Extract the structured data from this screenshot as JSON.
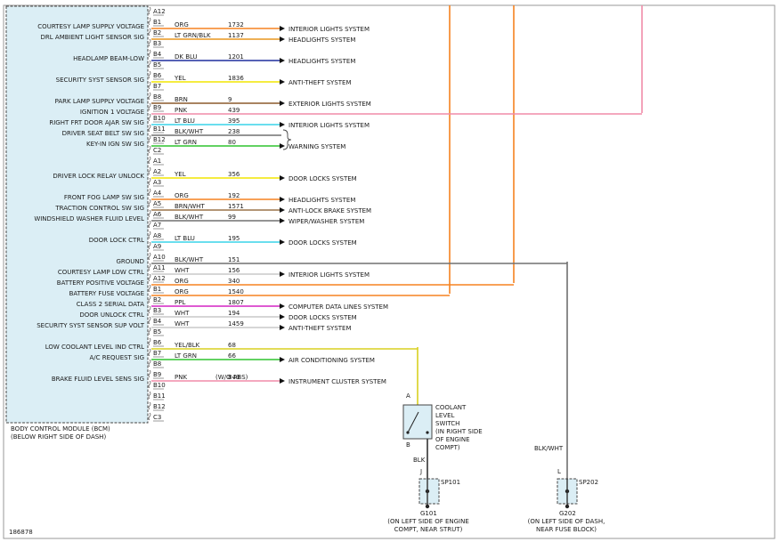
{
  "diagram": {
    "figure_id": "186878",
    "module": {
      "name_line1": "BODY CONTROL MODULE (BCM)",
      "name_line2": "(BELOW RIGHT SIDE OF DASH)"
    },
    "colors": {
      "module_fill": "#dbeef5",
      "ORG": "#f58220",
      "LT GRN/BLK": "#e8961e",
      "LT GRN": "#2ec42e",
      "DK BLU": "#1f2f9e",
      "YEL": "#f2e600",
      "BRN": "#8b5a2b",
      "PNK": "#f08ca8",
      "LT BLU": "#39d3e8",
      "BLK/WHT": "#707070",
      "BRN/WHT": "#9a7348",
      "WHT": "#c8c8c8",
      "PPL": "#d424c4",
      "YEL/BLK": "#d8d020",
      "BLK": "#333333"
    },
    "pins": [
      {
        "pin": "A12",
        "label": "",
        "color": "",
        "circuit": "",
        "dest": ""
      },
      {
        "pin": "B1",
        "label": "COURTESY LAMP SUPPLY VOLTAGE",
        "color": "ORG",
        "circuit": "1732",
        "dest": ""
      },
      {
        "pin": "B2",
        "label": "DRL AMBIENT LIGHT SENSOR SIG",
        "color": "LT GRN/BLK",
        "circuit": "1137",
        "dest": "INTERIOR LIGHTS SYSTEM"
      },
      {
        "pin": "B3",
        "label": "",
        "color": "",
        "circuit": "",
        "dest": "HEADLIGHTS SYSTEM"
      },
      {
        "pin": "B4",
        "label": "HEADLAMP BEAM-LOW",
        "color": "DK BLU",
        "circuit": "1201",
        "dest": ""
      },
      {
        "pin": "B5",
        "label": "",
        "color": "",
        "circuit": "",
        "dest": "HEADLIGHTS SYSTEM"
      },
      {
        "pin": "B6",
        "label": "SECURITY SYST SENSOR SIG",
        "color": "YEL",
        "circuit": "1836",
        "dest": ""
      },
      {
        "pin": "B7",
        "label": "",
        "color": "",
        "circuit": "",
        "dest": "ANTI-THEFT SYSTEM"
      },
      {
        "pin": "B8",
        "label": "PARK LAMP SUPPLY VOLTAGE",
        "color": "BRN",
        "circuit": "9",
        "dest": ""
      },
      {
        "pin": "B9",
        "label": "IGNITION 1 VOLTAGE",
        "color": "PNK",
        "circuit": "439",
        "dest": "EXTERIOR LIGHTS SYSTEM"
      },
      {
        "pin": "B10",
        "label": "RIGHT FRT DOOR AJAR SW SIG",
        "color": "LT BLU",
        "circuit": "395",
        "dest": ""
      },
      {
        "pin": "B11",
        "label": "DRIVER SEAT BELT SW SIG",
        "color": "BLK/WHT",
        "circuit": "238",
        "dest": "INTERIOR LIGHTS SYSTEM"
      },
      {
        "pin": "B12",
        "label": "KEY-IN IGN SW SIG",
        "color": "LT GRN",
        "circuit": "80",
        "dest": ""
      },
      {
        "pin": "C2",
        "label": "",
        "color": "",
        "circuit": "",
        "dest": "WARNING SYSTEM"
      },
      {
        "pin": "A1",
        "label": "",
        "color": "",
        "circuit": "",
        "dest": ""
      },
      {
        "pin": "A2",
        "label": "DRIVER LOCK RELAY UNLOCK",
        "color": "YEL",
        "circuit": "356",
        "dest": ""
      },
      {
        "pin": "A3",
        "label": "",
        "color": "",
        "circuit": "",
        "dest": "DOOR LOCKS SYSTEM"
      },
      {
        "pin": "A4",
        "label": "FRONT FOG LAMP SW SIG",
        "color": "ORG",
        "circuit": "192",
        "dest": ""
      },
      {
        "pin": "A5",
        "label": "TRACTION CONTROL SW SIG",
        "color": "BRN/WHT",
        "circuit": "1571",
        "dest": "HEADLIGHTS SYSTEM"
      },
      {
        "pin": "A6",
        "label": "WINDSHIELD WASHER FLUID LEVEL",
        "color": "BLK/WHT",
        "circuit": "99",
        "dest": "ANTI-LOCK BRAKE SYSTEM"
      },
      {
        "pin": "A7",
        "label": "",
        "color": "",
        "circuit": "",
        "dest": "WIPER/WASHER SYSTEM"
      },
      {
        "pin": "A8",
        "label": "DOOR LOCK CTRL",
        "color": "LT BLU",
        "circuit": "195",
        "dest": ""
      },
      {
        "pin": "A9",
        "label": "",
        "color": "",
        "circuit": "",
        "dest": "DOOR LOCKS SYSTEM"
      },
      {
        "pin": "A10",
        "label": "GROUND",
        "color": "BLK/WHT",
        "circuit": "151",
        "dest": ""
      },
      {
        "pin": "A11",
        "label": "COURTESY LAMP LOW CTRL",
        "color": "WHT",
        "circuit": "156",
        "dest": ""
      },
      {
        "pin": "A12",
        "label": "BATTERY POSITIVE VOLTAGE",
        "color": "ORG",
        "circuit": "340",
        "dest": "INTERIOR LIGHTS SYSTEM"
      },
      {
        "pin": "B1",
        "label": "BATTERY FUSE VOLTAGE",
        "color": "ORG",
        "circuit": "1540",
        "dest": ""
      },
      {
        "pin": "B2",
        "label": "CLASS 2 SERIAL DATA",
        "color": "PPL",
        "circuit": "1807",
        "dest": ""
      },
      {
        "pin": "B3",
        "label": "DOOR UNLOCK CTRL",
        "color": "WHT",
        "circuit": "194",
        "dest": "COMPUTER DATA LINES SYSTEM"
      },
      {
        "pin": "B4",
        "label": "SECURITY SYST SENSOR SUP VOLT",
        "color": "WHT",
        "circuit": "1459",
        "dest": "DOOR LOCKS SYSTEM"
      },
      {
        "pin": "B5",
        "label": "",
        "color": "",
        "circuit": "",
        "dest": "ANTI-THEFT SYSTEM"
      },
      {
        "pin": "B6",
        "label": "LOW COOLANT LEVEL IND CTRL",
        "color": "YEL/BLK",
        "circuit": "68",
        "dest": ""
      },
      {
        "pin": "B7",
        "label": "A/C REQUEST SIG",
        "color": "LT GRN",
        "circuit": "66",
        "dest": ""
      },
      {
        "pin": "B8",
        "label": "",
        "color": "",
        "circuit": "",
        "dest": "AIR CONDITIONING SYSTEM"
      },
      {
        "pin": "B9",
        "label": "BRAKE FLUID LEVEL SENS SIG",
        "color": "PNK",
        "circuit": "849",
        "note": "(W/O ABS)",
        "dest": ""
      },
      {
        "pin": "B10",
        "label": "",
        "color": "",
        "circuit": "",
        "dest": "INSTRUMENT CLUSTER SYSTEM"
      },
      {
        "pin": "B11",
        "label": "",
        "color": "",
        "circuit": "",
        "dest": ""
      },
      {
        "pin": "B12",
        "label": "",
        "color": "",
        "circuit": "",
        "dest": ""
      },
      {
        "pin": "C3",
        "label": "",
        "color": "",
        "circuit": "",
        "dest": ""
      }
    ],
    "switch": {
      "name": [
        "COOLANT",
        "LEVEL",
        "SWITCH",
        "(IN RIGHT SIDE",
        "OF ENGINE",
        "COMPT)"
      ],
      "pin_top": "A",
      "pin_bottom": "B",
      "wire_bottom": "BLK"
    },
    "splices": [
      {
        "pin": "J",
        "id": "SP101",
        "ground": "G101",
        "location_line1": "(ON LEFT SIDE OF ENGINE",
        "location_line2": "COMPT, NEAR STRUT)"
      },
      {
        "pin": "L",
        "id": "SP202",
        "ground": "G202",
        "location_line1": "(ON LEFT SIDE OF DASH,",
        "location_line2": "NEAR FUSE BLOCK)"
      }
    ],
    "ground_wire_color": "BLK/WHT"
  }
}
